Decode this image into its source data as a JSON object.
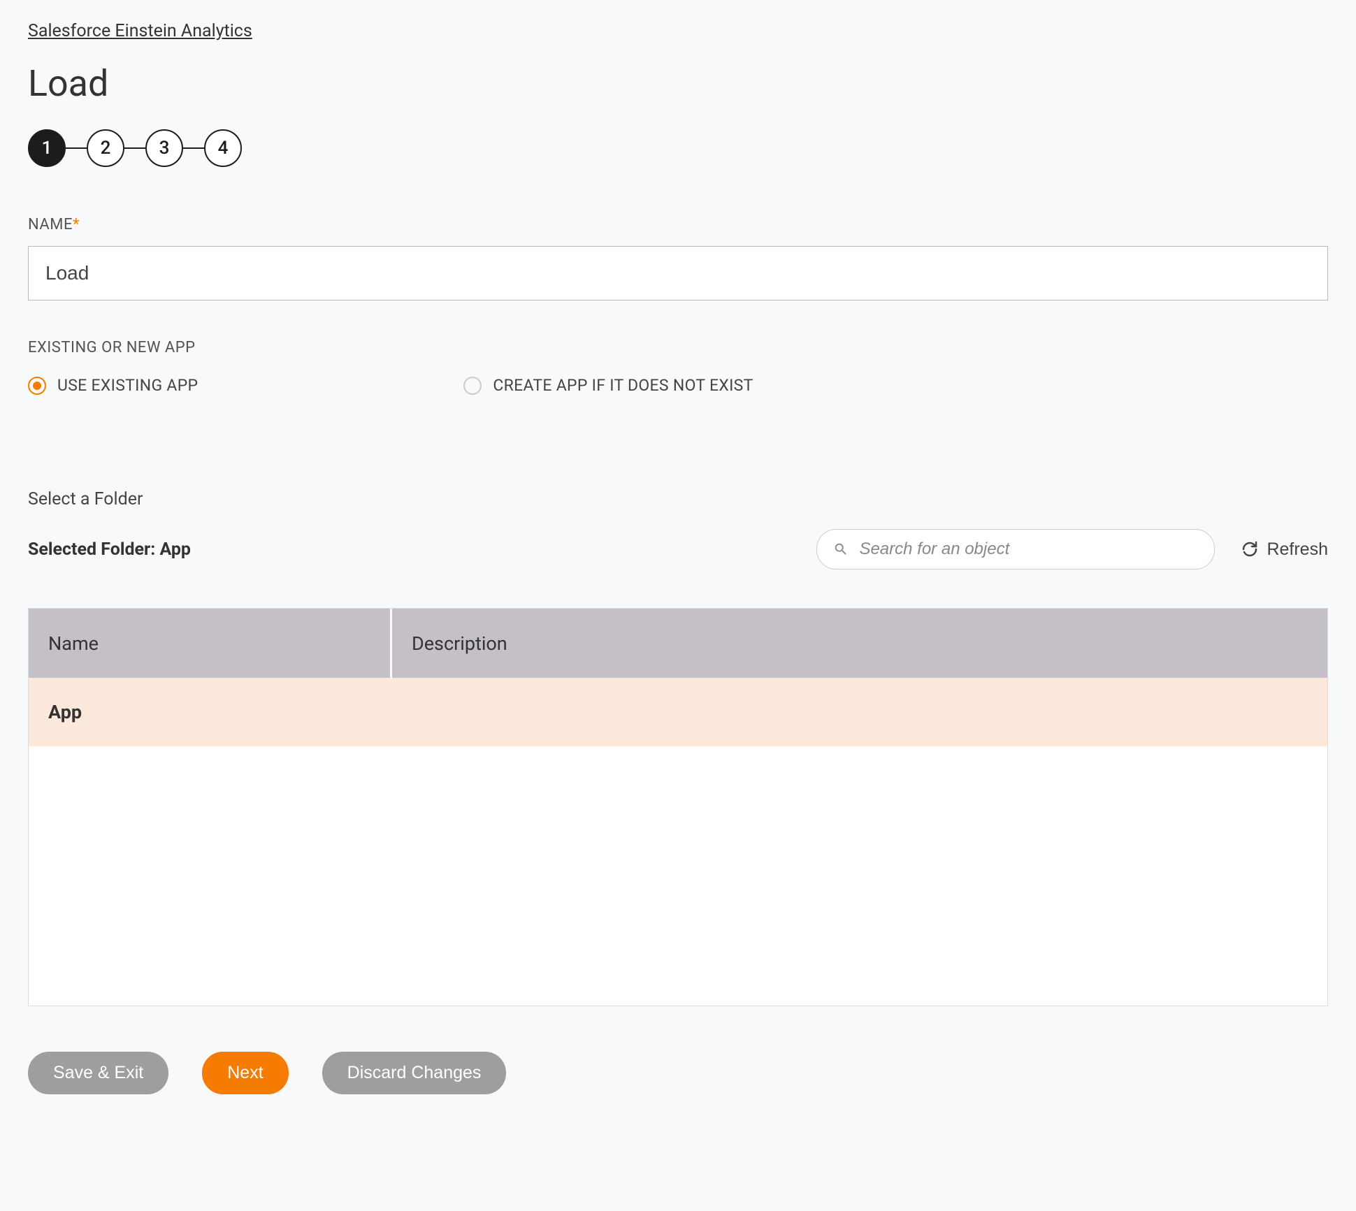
{
  "breadcrumb": {
    "label": "Salesforce Einstein Analytics"
  },
  "page_title": "Load",
  "stepper": {
    "steps": [
      "1",
      "2",
      "3",
      "4"
    ],
    "active": 0
  },
  "name_field": {
    "label": "NAME",
    "value": "Load"
  },
  "app_section": {
    "label": "EXISTING OR NEW APP",
    "options": [
      {
        "label": "USE EXISTING APP",
        "selected": true
      },
      {
        "label": "CREATE APP IF IT DOES NOT EXIST",
        "selected": false
      }
    ]
  },
  "folder_section": {
    "select_label": "Select a Folder",
    "selected_prefix": "Selected Folder: ",
    "selected_value": "App",
    "search_placeholder": "Search for an object",
    "refresh_label": "Refresh"
  },
  "table": {
    "columns": [
      "Name",
      "Description"
    ],
    "rows": [
      {
        "name": "App",
        "description": ""
      }
    ]
  },
  "buttons": {
    "save_exit": "Save & Exit",
    "next": "Next",
    "discard": "Discard Changes"
  }
}
